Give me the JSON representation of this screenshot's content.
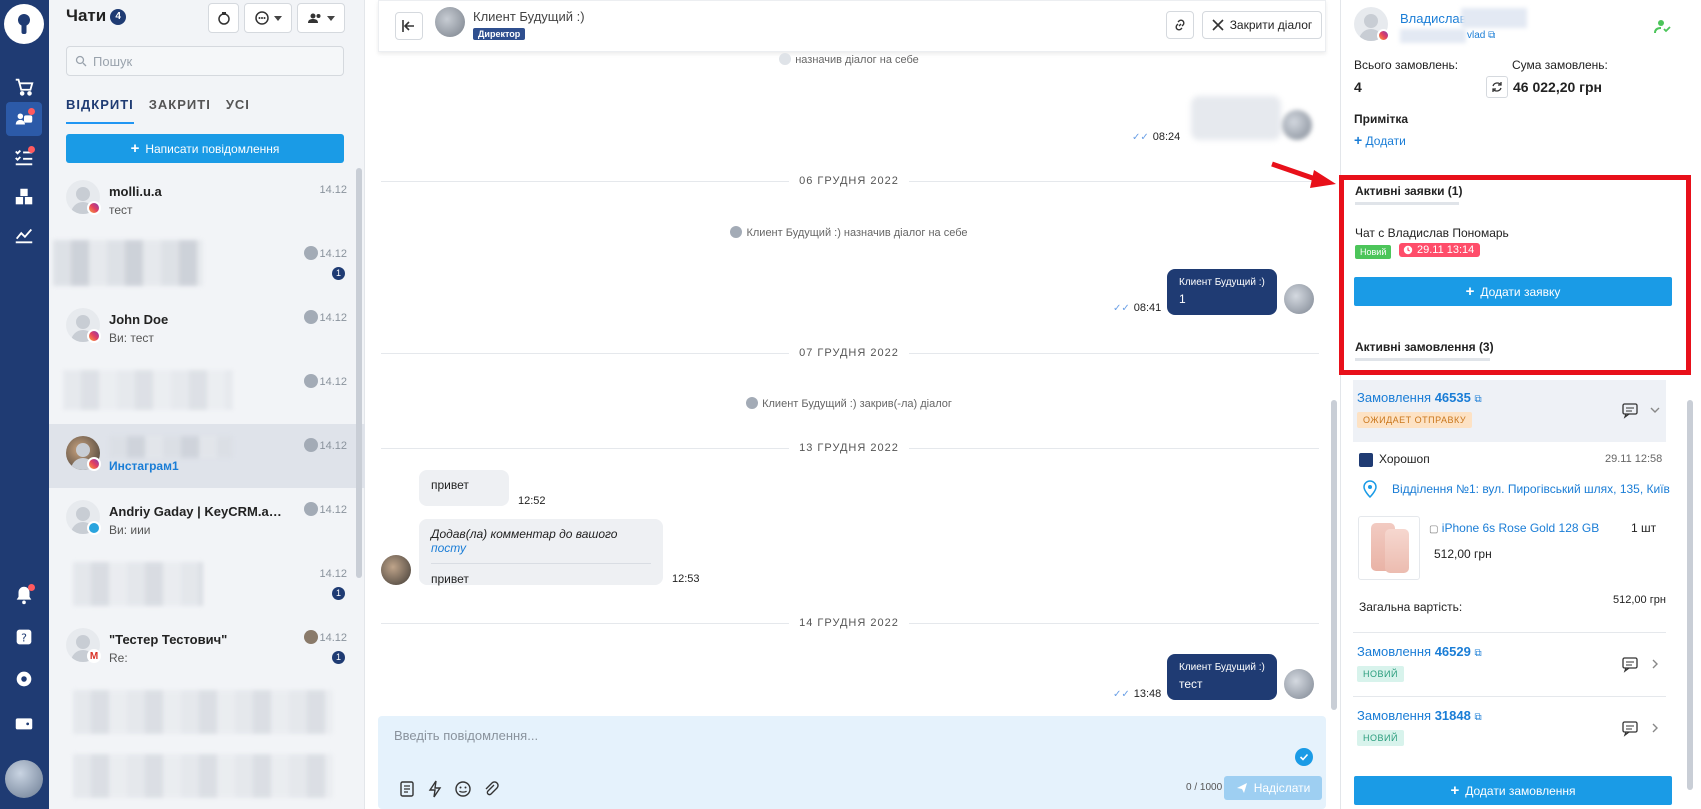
{
  "rail": {
    "items": [
      "logo-icon",
      "cart-icon",
      "chats-icon",
      "tasks-icon",
      "warehouse-icon",
      "analytics-icon",
      "bell-icon",
      "help-icon",
      "settings-icon",
      "wallet-icon"
    ]
  },
  "chats": {
    "title": "Чати",
    "count": "4",
    "search_placeholder": "Пошук",
    "tabs": [
      "ВІДКРИТІ",
      "ЗАКРИТІ",
      "УСІ"
    ],
    "write_label": "Написати повідомлення",
    "items": [
      {
        "name": "molli.u.a",
        "preview": "тест",
        "time": "14.12",
        "src": "instagram"
      },
      {
        "name": "",
        "preview": "",
        "time": "14.12",
        "unread": "1"
      },
      {
        "name": "John Doe",
        "preview": "Ви: тест",
        "time": "14.12",
        "src": "instagram"
      },
      {
        "name": "",
        "preview": "",
        "time": "14.12"
      },
      {
        "name": "",
        "preview": "Инстаграм1",
        "time": "14.12",
        "src": "instagram"
      },
      {
        "name": "Andriy Gaday | KeyCRM.app -...",
        "preview": "Ви: иии",
        "time": "14.12",
        "src": "telegram"
      },
      {
        "name": "",
        "preview": "",
        "time": "14.12",
        "unread": "1"
      },
      {
        "name": "\"Тестер Тестович\"",
        "preview": "Re:",
        "time": "14.12",
        "unread": "1",
        "src": "gmail"
      }
    ]
  },
  "chat": {
    "title": "Клиент Будущий :)",
    "role": "Директор",
    "close_label": "Закрити діалог",
    "sys1": "назначив діалог на себе",
    "t_blur": "08:24",
    "date1": "06 ГРУДНЯ 2022",
    "sys2": "Клиент Будущий :) назначив діалог на себе",
    "m1_sender": "Клиент Будущий :)",
    "m1_text": "1",
    "t1": "08:41",
    "date2": "07 ГРУДНЯ 2022",
    "sys3": "Клиент Будущий :) закрив(-ла) діалог",
    "date3": "13 ГРУДНЯ 2022",
    "in1": "привет",
    "t_in1": "12:52",
    "in2_pre": "Додав(ла) комментар до вашого",
    "in2_link": "посту",
    "in2_text": "привет",
    "t_in2": "12:53",
    "date4": "14 ГРУДНЯ 2022",
    "m2_sender": "Клиент Будущий :)",
    "m2_text": "тест",
    "t2": "13:48",
    "composer_placeholder": "Введіть повідомлення...",
    "counter": "0 / 1000",
    "send_label": "Надіслати"
  },
  "side": {
    "name": "Владислав",
    "handle": "vlad",
    "total_orders_label": "Всього замовлень:",
    "total_orders": "4",
    "sum_label": "Сума замовлень:",
    "sum": "46 022,20 грн",
    "note_label": "Примітка",
    "add_note": "Додати",
    "active_requests": "Активні заявки (1)",
    "request_title": "Чат с Владислав Пономарь",
    "request_status": "Новий",
    "request_date": "29.11 13:14",
    "add_request": "Додати заявку",
    "active_orders": "Активні замовлення (3)",
    "orders": [
      {
        "prefix": "Замовлення",
        "num": "46535",
        "status": "ОЖИДАЕТ ОТПРАВКУ",
        "status_color": "#fde2c4",
        "status_text_color": "#c9761b"
      },
      {
        "prefix": "Замовлення",
        "num": "46529",
        "status": "НОВИЙ",
        "status_color": "#d8f3ec",
        "status_text_color": "#2a9d7d"
      },
      {
        "prefix": "Замовлення",
        "num": "31848",
        "status": "НОВИЙ",
        "status_color": "#d8f3ec",
        "status_text_color": "#2a9d7d"
      }
    ],
    "shop": "Хорошоп",
    "shop_date": "29.11 12:58",
    "address": "Відділення №1: вул. Пирогівський шлях, 135, Київ",
    "product": "iPhone 6s Rose Gold 128 GB",
    "qty": "1 шт",
    "price": "512,00 грн",
    "total_label": "Загальна вартість:",
    "total": "512,00 грн",
    "add_order": "Додати замовлення"
  }
}
